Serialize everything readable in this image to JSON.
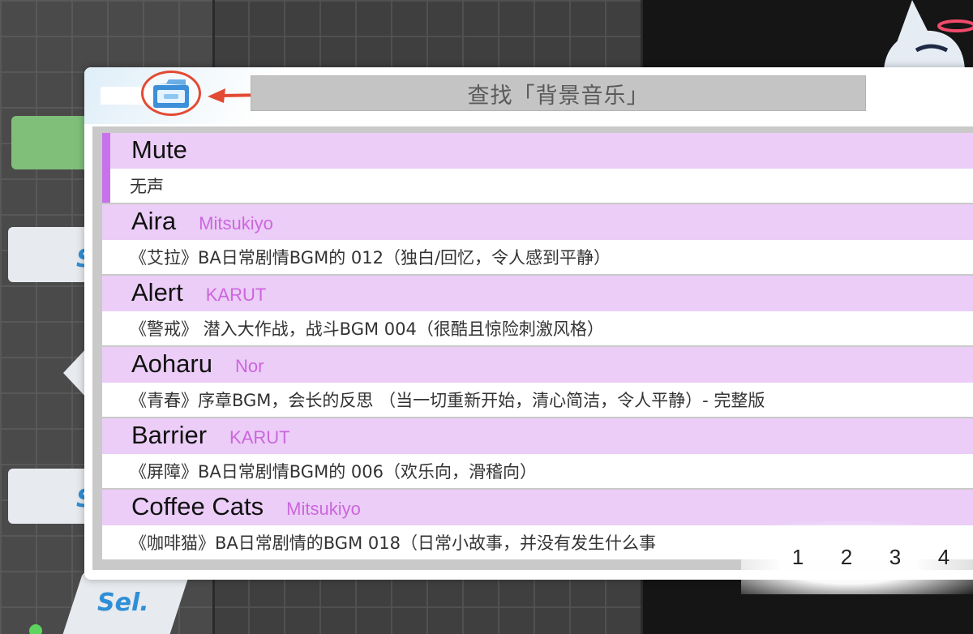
{
  "search": {
    "placeholder": "查找「背景音乐」"
  },
  "songs": [
    {
      "name": "Mute",
      "artist": "",
      "description": "无声",
      "selected": true
    },
    {
      "name": "Aira",
      "artist": "Mitsukiyo",
      "description": "《艾拉》BA日常剧情BGM的 012（独白/回忆，令人感到平静）"
    },
    {
      "name": "Alert",
      "artist": "KARUT",
      "description": "《警戒》 潜入大作战，战斗BGM 004（很酷且惊险刺激风格）"
    },
    {
      "name": "Aoharu",
      "artist": "Nor",
      "description": "《青春》序章BGM，会长的反思 （当一切重新开始，清心简洁，令人平静）- 完整版"
    },
    {
      "name": "Barrier",
      "artist": "KARUT",
      "description": "《屏障》BA日常剧情BGM的 006（欢乐向，滑稽向）"
    },
    {
      "name": "Coffee Cats",
      "artist": "Mitsukiyo",
      "description": "《咖啡猫》BA日常剧情的BGM 018（日常小故事，并没有发生什么事"
    }
  ],
  "pagination": {
    "pages": [
      "1",
      "2",
      "3",
      "4"
    ],
    "current": "1"
  },
  "background": {
    "sel_label": "Sel."
  },
  "colors": {
    "highlight_row": "#ebcdf7",
    "accent": "#c772ea",
    "artist": "#cc66dd",
    "search_bg": "#c4c4c4",
    "annotation": "#e34a33"
  },
  "icons": {
    "folder": "folder-icon",
    "arrow": "annotation-arrow"
  }
}
